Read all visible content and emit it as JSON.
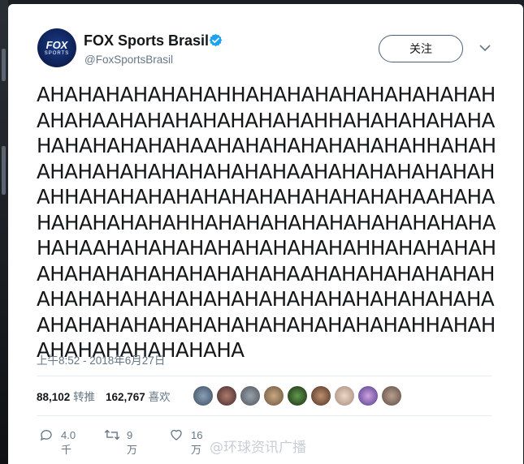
{
  "account": {
    "name": "FOX Sports Brasil",
    "handle": "@FoxSportsBrasil",
    "avatar_text_main": "FOX",
    "avatar_text_sub": "SPORTS"
  },
  "header": {
    "follow_label": "关注"
  },
  "tweet": {
    "text": "AHAHAHAHAHAHAHHAHAHAHAHAHAHAHAHAHAHAHAAHAHAHAHAHAHAHAHHAHAHAHAHAHAHAHAHAHAHAHAAHAHAHAHAHAHAHAHHAHAHAHAHAHAHAHAHAHAHAHAAHAHAHAHAHAHAHAHHAHAHAHAHAHAHAHAHAHAHAHAHAAHAHAHAHAHAHAHAHHAHAHAHAHAHAHAHAHAHAHAHAHAAHAHAHAHAHAHAHAHAHAHHAHAHAHAHAHAHAHAHAHAHAHAHAHAAHAHAHAHAHAHAHAHAHAHAHAHAHAHAHAHAHAHAHAHAHAHAHAAHAHAHAHAHAHAHAHAHAHAHAHAHAHHAHAHAHAHAHAHAHAHAHA",
    "timestamp": "上午8:52 - 2018年6月27日"
  },
  "stats": {
    "retweets_count": "88,102",
    "retweets_label": "转推",
    "likes_count": "162,767",
    "likes_label": "喜欢"
  },
  "actions": {
    "reply_count": "4.0千",
    "retweet_count": "9万",
    "like_count": "16万"
  },
  "watermark": "@环球资讯广播",
  "colors": {
    "verified": "#1da1f2",
    "secondary_text": "#657786",
    "primary_text": "#14171a"
  }
}
